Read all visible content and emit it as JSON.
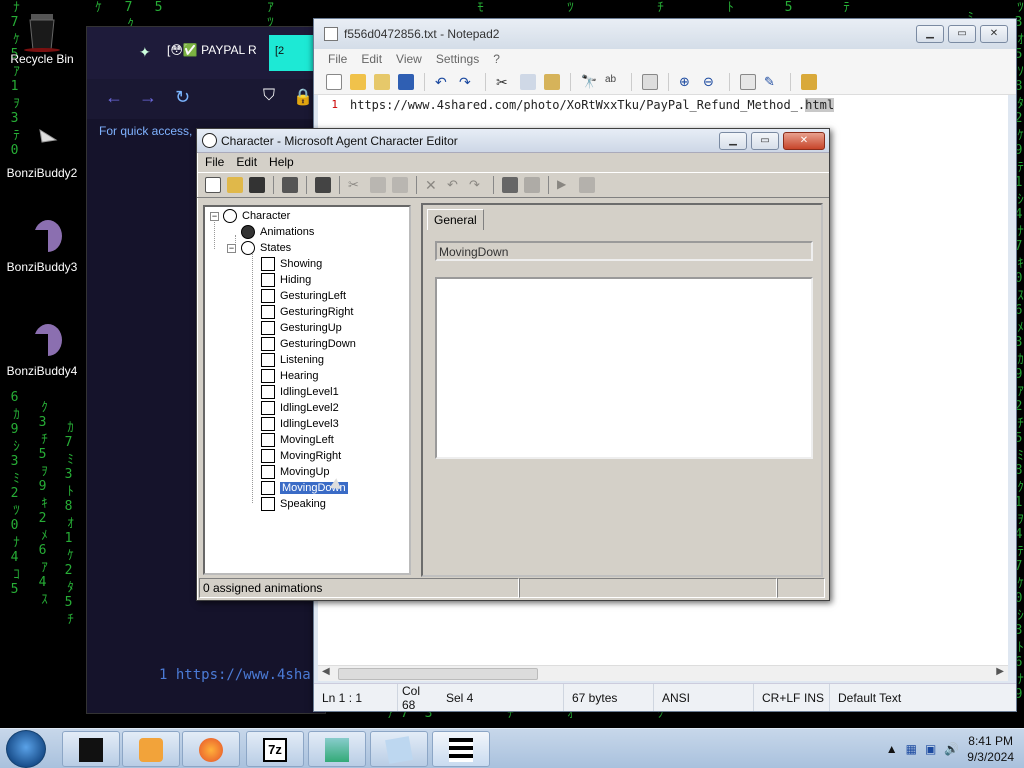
{
  "desktop": {
    "icons": [
      {
        "label": "Recycle Bin"
      },
      {
        "label": "BonziBuddy2"
      },
      {
        "label": "BonziBuddy3"
      },
      {
        "label": "BonziBuddy4"
      }
    ]
  },
  "browser": {
    "tab_label": "[😳✅ PAYPAL R",
    "tab_active_label": "[2",
    "quick_access_text": "For quick access, p",
    "page_url_fragment": "1 https://www.4sha"
  },
  "notepad": {
    "title": "f556d0472856.txt - Notepad2",
    "menu": [
      "File",
      "Edit",
      "View",
      "Settings",
      "?"
    ],
    "line_number": "1",
    "line_text": "https://www.4shared.com/photo/XoRtWxxTku/PayPal_Refund_Method_.",
    "line_selected": "html",
    "status": {
      "position": "Ln 1 : 1",
      "col": "Col 68",
      "sel": "Sel 4",
      "size": "67 bytes",
      "encoding": "ANSI",
      "eol": "CR+LF",
      "mode": "INS",
      "scheme": "Default Text"
    }
  },
  "character_editor": {
    "title": "Character - Microsoft Agent Character Editor",
    "menu": [
      "File",
      "Edit",
      "Help"
    ],
    "tree": {
      "root": "Character",
      "animations": "Animations",
      "states": "States",
      "state_items": [
        "Showing",
        "Hiding",
        "GesturingLeft",
        "GesturingRight",
        "GesturingUp",
        "GesturingDown",
        "Listening",
        "Hearing",
        "IdlingLevel1",
        "IdlingLevel2",
        "IdlingLevel3",
        "MovingLeft",
        "MovingRight",
        "MovingUp",
        "MovingDown",
        "Speaking"
      ],
      "selected_item": "MovingDown"
    },
    "tab_label": "General",
    "name_field_value": "MovingDown",
    "status_text": "0 assigned animations"
  },
  "taskbar": {
    "time": "8:41 PM",
    "date": "9/3/2024",
    "apps": [
      "app-1",
      "media-player",
      "firefox",
      "7zip",
      "image-viewer",
      "notes",
      "film"
    ]
  },
  "colors": {
    "matrix_green": "#2ecc40",
    "selection_blue": "#3a6bc6",
    "browser_accent": "#1de9d5"
  }
}
